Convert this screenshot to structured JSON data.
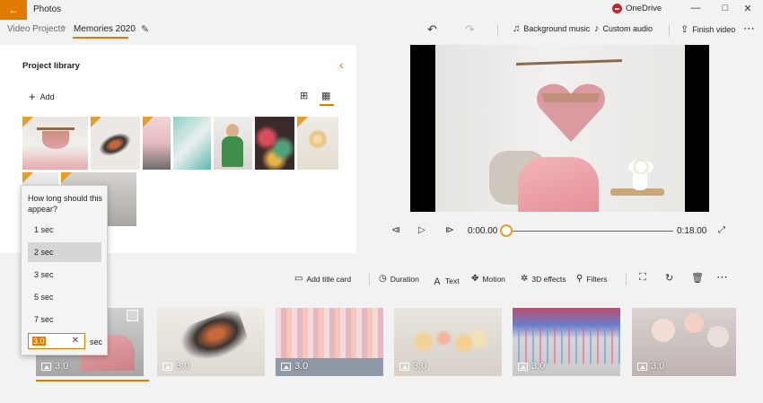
{
  "app": {
    "title": "Photos",
    "back_icon": "back-arrow-icon",
    "accent": "#e07b00"
  },
  "titlebar": {
    "onedrive_label": "OneDrive",
    "minimize": "—",
    "maximize": "□",
    "close": "✕"
  },
  "breadcrumb": {
    "root": "Video Projects",
    "separator": ">",
    "current": "Memories 2020"
  },
  "commands": {
    "background_music": "Background music",
    "custom_audio": "Custom audio",
    "finish_video": "Finish video"
  },
  "library": {
    "title": "Project library",
    "add_label": "Add"
  },
  "playback": {
    "current_time": "0:00.00",
    "total_time": "0:18.00",
    "progress": 0
  },
  "storyboard": {
    "toolbar": {
      "add_title_card": "Add title card",
      "duration": "Duration",
      "text": "Text",
      "motion": "Motion",
      "effects_3d": "3D effects",
      "filters": "Filters"
    },
    "cards": [
      {
        "duration": "3.0"
      },
      {
        "duration": "3.0"
      },
      {
        "duration": "3.0"
      },
      {
        "duration": "3.0"
      },
      {
        "duration": "3.0"
      },
      {
        "duration": "3.0"
      }
    ]
  },
  "duration_popup": {
    "question": "How long should this appear?",
    "options": [
      "1 sec",
      "2 sec",
      "3 sec",
      "5 sec",
      "7 sec"
    ],
    "selected": "2 sec",
    "custom_value": "3.0",
    "unit": "sec"
  }
}
